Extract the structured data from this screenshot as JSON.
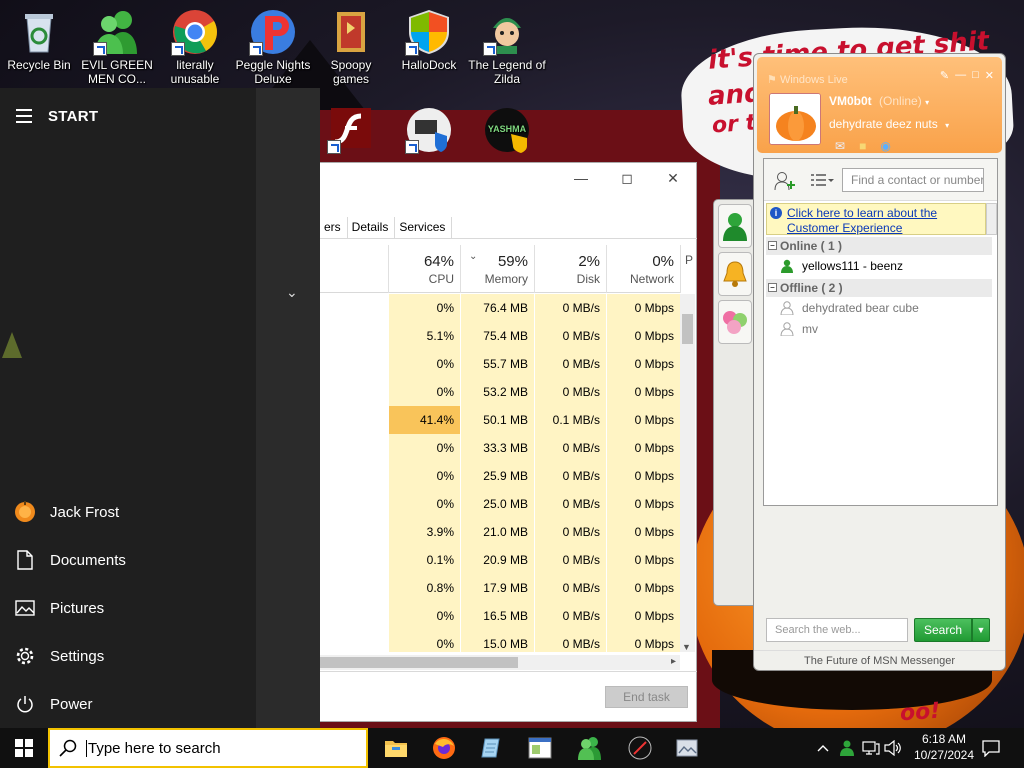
{
  "desktop": {
    "icons": [
      {
        "label": "Recycle Bin",
        "icon": "recycle-bin-icon"
      },
      {
        "label": "EVIL GREEN MEN CO...",
        "icon": "green-men-icon"
      },
      {
        "label": "literally unusable",
        "icon": "chrome-icon"
      },
      {
        "label": "Peggle Nights Deluxe",
        "icon": "peggle-icon"
      },
      {
        "label": "Spoopy games",
        "icon": "folder-icon"
      },
      {
        "label": "HalloDock",
        "icon": "shield-icon"
      },
      {
        "label": "The Legend of Zilda",
        "icon": "zilda-icon"
      }
    ],
    "partial_icons": [
      {
        "label": "F",
        "icon": "flash-icon"
      },
      {
        "label": "",
        "icon": "network-shield-icon"
      },
      {
        "label": "",
        "icon": "yashma-icon",
        "badge": "YASHMA"
      }
    ],
    "wallpaper_text": [
      "it's time to get shit",
      "and",
      "or t",
      "oo!"
    ]
  },
  "start_menu": {
    "title": "START",
    "items": [
      {
        "label": "Jack Frost",
        "icon": "user-avatar-icon"
      },
      {
        "label": "Documents",
        "icon": "document-icon"
      },
      {
        "label": "Pictures",
        "icon": "pictures-icon"
      },
      {
        "label": "Settings",
        "icon": "gear-icon"
      },
      {
        "label": "Power",
        "icon": "power-icon"
      }
    ]
  },
  "task_manager": {
    "tabs": [
      "ers",
      "Details",
      "Services"
    ],
    "columns": [
      {
        "pct": "64%",
        "label": "CPU"
      },
      {
        "pct": "59%",
        "label": "Memory"
      },
      {
        "pct": "2%",
        "label": "Disk"
      },
      {
        "pct": "0%",
        "label": "Network"
      },
      {
        "pct": "",
        "label": "P"
      }
    ],
    "rows": [
      {
        "cpu": "0%",
        "mem": "76.4 MB",
        "disk": "0 MB/s",
        "net": "0 Mbps"
      },
      {
        "cpu": "5.1%",
        "mem": "75.4 MB",
        "disk": "0 MB/s",
        "net": "0 Mbps"
      },
      {
        "cpu": "0%",
        "mem": "55.7 MB",
        "disk": "0 MB/s",
        "net": "0 Mbps"
      },
      {
        "cpu": "0%",
        "mem": "53.2 MB",
        "disk": "0 MB/s",
        "net": "0 Mbps"
      },
      {
        "cpu": "41.4%",
        "mem": "50.1 MB",
        "disk": "0.1 MB/s",
        "net": "0 Mbps",
        "hot": true
      },
      {
        "cpu": "0%",
        "mem": "33.3 MB",
        "disk": "0 MB/s",
        "net": "0 Mbps"
      },
      {
        "cpu": "0%",
        "mem": "25.9 MB",
        "disk": "0 MB/s",
        "net": "0 Mbps"
      },
      {
        "cpu": "0%",
        "mem": "25.0 MB",
        "disk": "0 MB/s",
        "net": "0 Mbps"
      },
      {
        "cpu": "3.9%",
        "mem": "21.0 MB",
        "disk": "0 MB/s",
        "net": "0 Mbps"
      },
      {
        "cpu": "0.1%",
        "mem": "20.9 MB",
        "disk": "0 MB/s",
        "net": "0 Mbps"
      },
      {
        "cpu": "0.8%",
        "mem": "17.9 MB",
        "disk": "0 MB/s",
        "net": "0 Mbps"
      },
      {
        "cpu": "0%",
        "mem": "16.5 MB",
        "disk": "0 MB/s",
        "net": "0 Mbps"
      },
      {
        "cpu": "0%",
        "mem": "15.0 MB",
        "disk": "0 MB/s",
        "net": "0 Mbps"
      }
    ],
    "end_task_label": "End task",
    "colors": {
      "heat_low": "#fff4c4",
      "heat_high": "#f9c45a"
    }
  },
  "messenger": {
    "title": "Windows Live",
    "user_name": "VM0b0t",
    "status": "(Online)",
    "mood": "dehydrate deez nuts",
    "find_placeholder": "Find a contact or number...",
    "banner": "Click here to learn about the Customer Experience",
    "groups": [
      {
        "label": "Online ( 1 )",
        "contacts": [
          {
            "name": "yellows111 - beenz",
            "online": true
          }
        ]
      },
      {
        "label": "Offline ( 2 )",
        "contacts": [
          {
            "name": "dehydrated bear cube",
            "online": false
          },
          {
            "name": "mv",
            "online": false
          }
        ]
      }
    ],
    "search_placeholder": "Search the web...",
    "search_button": "Search",
    "footer": "The Future of MSN Messenger",
    "colors": {
      "header": "#f9a24a",
      "online": "#2c9b2c",
      "offline": "#a5a5a5"
    }
  },
  "taskbar": {
    "search_placeholder": "Type here to search",
    "apps": [
      "file-explorer-icon",
      "firefox-icon",
      "notepad-icon",
      "window-app-icon",
      "messenger-icon",
      "media-icon",
      "photo-icon"
    ],
    "time": "6:18 AM",
    "date": "10/27/2024"
  }
}
